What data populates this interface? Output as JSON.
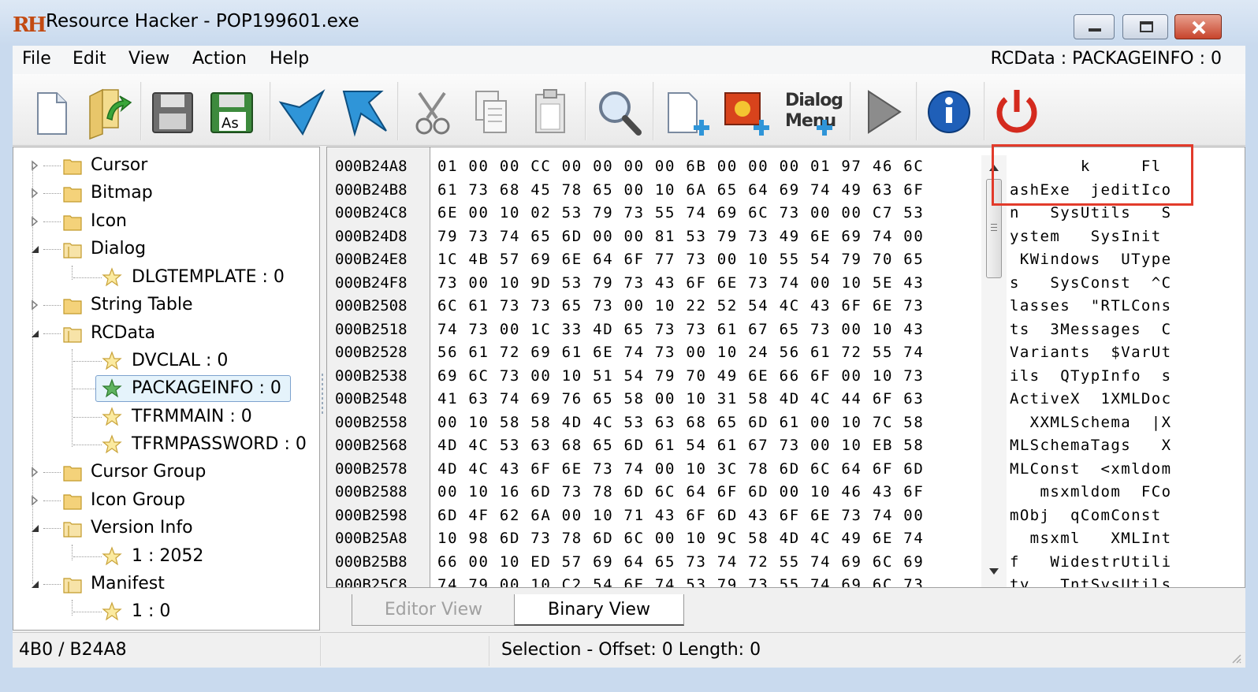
{
  "window": {
    "app_icon": "RH",
    "title": "Resource Hacker - POP199601.exe"
  },
  "menubar": {
    "items": [
      "File",
      "Edit",
      "View",
      "Action",
      "Help"
    ],
    "current_resource": "RCData : PACKAGEINFO : 0"
  },
  "toolbar": {
    "buttons": [
      "new-file-icon",
      "open-file-icon",
      "save-icon",
      "save-as-icon",
      "compile-icon",
      "bookmark-icon",
      "cut-icon",
      "copy-icon",
      "paste-icon",
      "find-icon",
      "add-blank-resource-icon",
      "add-image-resource-icon",
      "dialog-menu-icon",
      "run-script-icon",
      "about-icon",
      "exit-icon"
    ],
    "save_as_label": "As",
    "dialog_menu_label_1": "Dialog",
    "dialog_menu_label_2": "Menu"
  },
  "tree": {
    "nodes": [
      {
        "label": "Cursor"
      },
      {
        "label": "Bitmap"
      },
      {
        "label": "Icon"
      },
      {
        "label": "Dialog"
      },
      {
        "label": "DLGTEMPLATE : 0"
      },
      {
        "label": "String Table"
      },
      {
        "label": "RCData"
      },
      {
        "label": "DVCLAL : 0"
      },
      {
        "label": "PACKAGEINFO : 0"
      },
      {
        "label": "TFRMMAIN : 0"
      },
      {
        "label": "TFRMPASSWORD : 0"
      },
      {
        "label": "Cursor Group"
      },
      {
        "label": "Icon Group"
      },
      {
        "label": "Version Info"
      },
      {
        "label": "1 : 2052"
      },
      {
        "label": "Manifest"
      },
      {
        "label": "1 : 0"
      }
    ]
  },
  "hex": {
    "addresses": [
      "000B24A8",
      "000B24B8",
      "000B24C8",
      "000B24D8",
      "000B24E8",
      "000B24F8",
      "000B2508",
      "000B2518",
      "000B2528",
      "000B2538",
      "000B2548",
      "000B2558",
      "000B2568",
      "000B2578",
      "000B2588",
      "000B2598",
      "000B25A8",
      "000B25B8",
      "000B25C8"
    ],
    "bytes": [
      "01 00 00 CC 00 00 00 00 6B 00 00 00 01 97 46 6C",
      "61 73 68 45 78 65 00 10 6A 65 64 69 74 49 63 6F",
      "6E 00 10 02 53 79 73 55 74 69 6C 73 00 00 C7 53",
      "79 73 74 65 6D 00 00 81 53 79 73 49 6E 69 74 00",
      "1C 4B 57 69 6E 64 6F 77 73 00 10 55 54 79 70 65",
      "73 00 10 9D 53 79 73 43 6F 6E 73 74 00 10 5E 43",
      "6C 61 73 73 65 73 00 10 22 52 54 4C 43 6F 6E 73",
      "74 73 00 1C 33 4D 65 73 73 61 67 65 73 00 10 43",
      "56 61 72 69 61 6E 74 73 00 10 24 56 61 72 55 74",
      "69 6C 73 00 10 51 54 79 70 49 6E 66 6F 00 10 73",
      "41 63 74 69 76 65 58 00 10 31 58 4D 4C 44 6F 63",
      "00 10 58 58 4D 4C 53 63 68 65 6D 61 00 10 7C 58",
      "4D 4C 53 63 68 65 6D 61 54 61 67 73 00 10 EB 58",
      "4D 4C 43 6F 6E 73 74 00 10 3C 78 6D 6C 64 6F 6D",
      "00 10 16 6D 73 78 6D 6C 64 6F 6D 00 10 46 43 6F",
      "6D 4F 62 6A 00 10 71 43 6F 6D 43 6F 6E 73 74 00",
      "10 98 6D 73 78 6D 6C 00 10 9C 58 4D 4C 49 6E 74",
      "66 00 10 ED 57 69 64 65 73 74 72 55 74 69 6C 69",
      "74 79 00 10 C2 54 6E 74 53 79 73 55 74 69 6C 73"
    ],
    "ascii": [
      "       k     Fl",
      "ashExe  jeditIco",
      "n   SysUtils   S",
      "ystem   SysInit",
      " KWindows  UType",
      "s   SysConst  ^C",
      "lasses  \"RTLCons",
      "ts  3Messages  C",
      "Variants  $VarUt",
      "ils  QTypInfo  s",
      "ActiveX  1XMLDoc",
      "  XXMLSchema  |X",
      "MLSchemaTags   X",
      "MLConst  <xmldom",
      "   msxmldom  FCo",
      "mObj  qComConst",
      "  msxml   XMLInt",
      "f   WidestrUtili",
      "ty   TntSysUtils"
    ]
  },
  "tabs": {
    "editor_view": "Editor View",
    "binary_view": "Binary View"
  },
  "status": {
    "position": "4B0 / B24A8",
    "selection": "Selection - Offset: 0  Length: 0"
  },
  "colors": {
    "highlight_box": "#e23b2b",
    "selected_tree_bg": "#e5f3fb",
    "title_bar": "#c9daee"
  }
}
